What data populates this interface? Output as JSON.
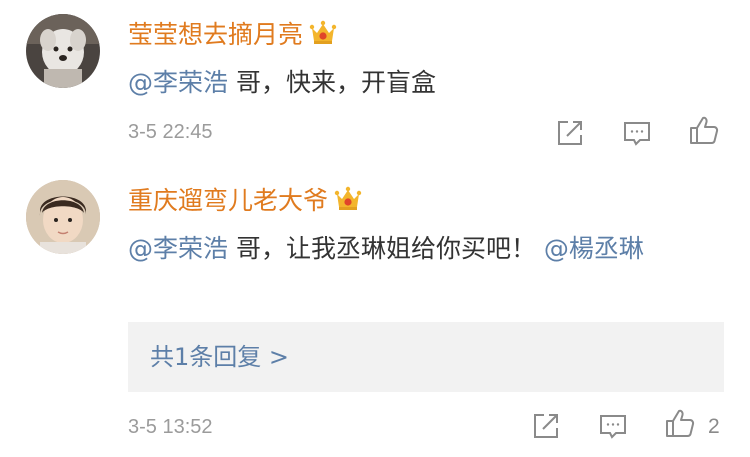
{
  "colors": {
    "username": "#e07b1f",
    "mention": "#5d7fa8",
    "text": "#333333",
    "meta": "#9b9b9b",
    "reply_box_bg": "#f2f2f2",
    "crown": "#f3b52c"
  },
  "comments": [
    {
      "username": "莹莹想去摘月亮",
      "badge_icon": "crown-vip-icon",
      "mention": "@李荣浩",
      "text": " 哥，快来，开盲盒",
      "timestamp": "3-5 22:45",
      "actions": [
        "share-icon",
        "reply-icon",
        "like-icon"
      ]
    },
    {
      "username": "重庆遛弯儿老大爷",
      "badge_icon": "crown-vip-icon",
      "mention": "@李荣浩",
      "text": " 哥，让我丞琳姐给你买吧！",
      "mention_2": "@楊丞琳",
      "timestamp": "3-5 13:52",
      "reply_summary": "共1条回复 >",
      "like_count": "2",
      "actions": [
        "share-icon",
        "reply-icon",
        "like-icon"
      ]
    }
  ]
}
